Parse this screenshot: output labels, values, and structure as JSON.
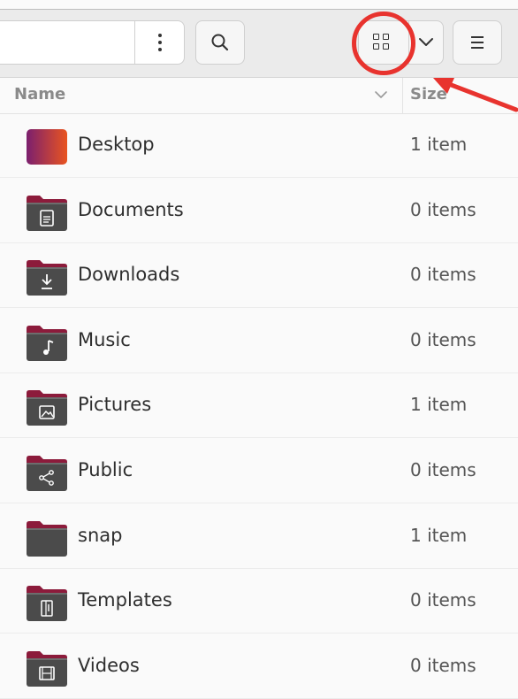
{
  "toolbar": {
    "menu_icon": "vertical-ellipsis-icon",
    "search_icon": "magnifier-icon",
    "view_icon": "grid-view-icon",
    "view_dropdown_icon": "chevron-down-icon",
    "hamburger_icon": "hamburger-menu-icon"
  },
  "columns": {
    "name": "Name",
    "size": "Size"
  },
  "annotation": {
    "color": "#e8332e",
    "shapes": [
      "circle",
      "arrow"
    ]
  },
  "files": [
    {
      "name": "Desktop",
      "size": "1 item",
      "icon": "desktop-folder-icon"
    },
    {
      "name": "Documents",
      "size": "0 items",
      "icon": "documents-folder-icon"
    },
    {
      "name": "Downloads",
      "size": "0 items",
      "icon": "downloads-folder-icon"
    },
    {
      "name": "Music",
      "size": "0 items",
      "icon": "music-folder-icon"
    },
    {
      "name": "Pictures",
      "size": "1 item",
      "icon": "pictures-folder-icon"
    },
    {
      "name": "Public",
      "size": "0 items",
      "icon": "public-folder-icon"
    },
    {
      "name": "snap",
      "size": "1 item",
      "icon": "folder-icon"
    },
    {
      "name": "Templates",
      "size": "0 items",
      "icon": "templates-folder-icon"
    },
    {
      "name": "Videos",
      "size": "0 items",
      "icon": "videos-folder-icon"
    }
  ],
  "colors": {
    "folder_tab": "#8c1b3b",
    "folder_body": "#4b4b4b",
    "desktop_gradient_start": "#7b1f6e",
    "desktop_gradient_end": "#e95420"
  }
}
